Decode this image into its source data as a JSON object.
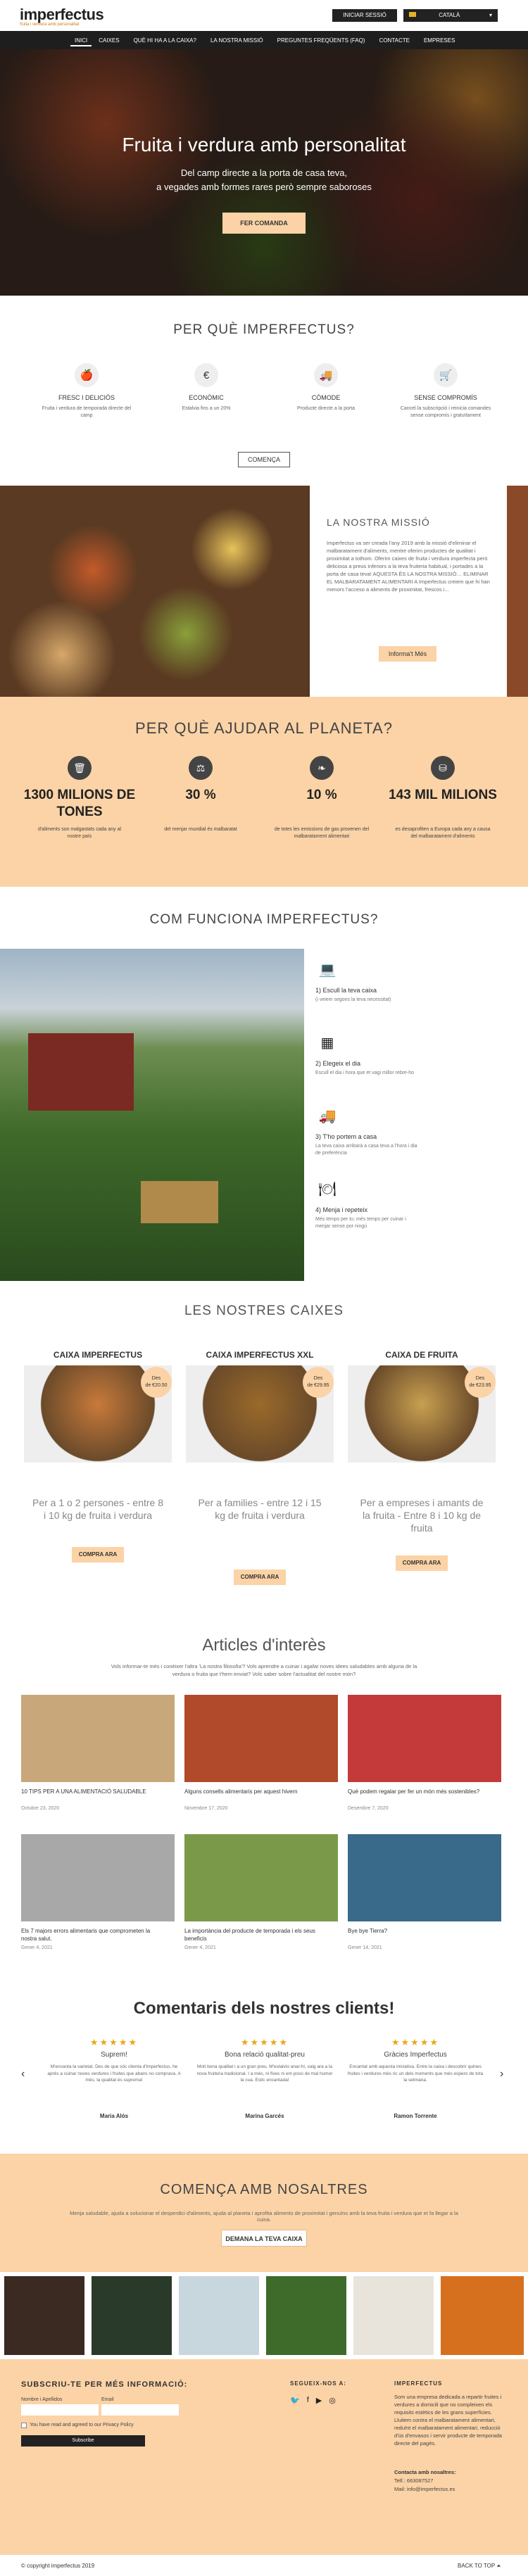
{
  "header": {
    "logo": "imperfectus",
    "tagline": "fruita i verdura amb personalitat",
    "login": "INICIAR SESSIÓ",
    "lang": "CATALÀ"
  },
  "nav": [
    "INICI",
    "CAIXES",
    "QUÈ HI HA A LA CAIXA?",
    "LA NOSTRA MISSIÓ",
    "PREGUNTES FREQÜENTS (FAQ)",
    "CONTACTE",
    "EMPRESES"
  ],
  "hero": {
    "title": "Fruita i verdura amb personalitat",
    "sub1": "Del camp directe a la porta de casa teva,",
    "sub2": "a vegades amb formes rares però sempre saboroses",
    "button": "FER COMANDA"
  },
  "why": {
    "title": "PER QUÈ IMPERFECTUS?",
    "items": [
      {
        "icon": "apple-icon",
        "title": "FRESC I DELICIÓS",
        "text": "Fruita i verdura de temporada directe del camp"
      },
      {
        "icon": "euro-icon",
        "title": "ECONÒMIC",
        "text": "Estalvia fins a un 20%"
      },
      {
        "icon": "truck-icon",
        "title": "CÒMODE",
        "text": "Producte directe a la porta"
      },
      {
        "icon": "cart-icon",
        "title": "SENSE COMPROMÍS",
        "text": "Cancel·la subscripció i reinicia comandes sense compromís i gratuïtament"
      }
    ],
    "button": "COMENÇA"
  },
  "mission": {
    "title": "LA NOSTRA MISSIÓ",
    "text": "Imperfectus va ser creada l'any 2019 amb la missió d'eliminar el malbaratament d'aliments, mentre oferim productes de qualitat i proximitat a tothom. Oferim caixes de fruita i verdura imperfecta però deliciosa a preus inferiors a la teva fruiteria habitual, i portades a la porta de casa teva! AQUESTA ÉS LA NOSTRA MISSIÓ… ELIMINAR EL MALBARATAMENT ALIMENTARI A Imperfectus creiem que hi han menors l'acceso a aliments de proximitat, frescos i...",
    "button": "Informa't Més"
  },
  "planet": {
    "title": "PER QUÈ AJUDAR AL PLANETA?",
    "stats": [
      {
        "icon": "trash-icon",
        "value": "1300 MILIONS DE TONES",
        "text": "d'aliments son malgastats cada any al nostre país"
      },
      {
        "icon": "scale-icon",
        "value": "30 %",
        "text": "del menjar mundial és malbaratat"
      },
      {
        "icon": "leaf-icon",
        "value": "10 %",
        "text": "de totes les emissions de gas provenen del malbaratament alimentari"
      },
      {
        "icon": "coins-icon",
        "value": "143 MIL MILIONS",
        "text": "es desaprofiten a Europa cada any a causa del malbaratament d'aliments"
      }
    ]
  },
  "how": {
    "title": "COM FUNCIONA IMPERFECTUS?",
    "steps": [
      {
        "icon": "laptop-icon",
        "title": "1) Escull la teva caixa",
        "text": "(i veiem segons la teva necessitat)"
      },
      {
        "icon": "calendar-icon",
        "title": "2) Elegeix el dia",
        "text": "Escull el dia i hora que et vagi millor rebre-ho"
      },
      {
        "icon": "delivery-icon",
        "title": "3) T'ho portem a casa",
        "text": "La teva caixa arribarà a casa teva a l'hora i dia de preferència"
      },
      {
        "icon": "cloche-icon",
        "title": "4) Menja i repeteix",
        "text": "Més temps per tu: més temps per cuinar i menjar sense por ningú"
      }
    ]
  },
  "boxes": {
    "title": "LES NOSTRES CAIXES",
    "items": [
      {
        "title": "CAIXA IMPERFECTUS",
        "badge_line1": "Des",
        "badge_line2": "de €20.50",
        "desc": "Per a 1 o 2 persones - entre 8 i 10 kg de fruita i verdura",
        "button": "COMPRA ARA"
      },
      {
        "title": "CAIXA IMPERFECTUS XXL",
        "badge_line1": "Des",
        "badge_line2": "de €29.95",
        "desc": "Per a families - entre 12 i 15 kg de fruita i verdura",
        "button": "COMPRA ARA"
      },
      {
        "title": "CAIXA DE FRUITA",
        "badge_line1": "Des",
        "badge_line2": "de €23.95",
        "desc": "Per a empreses i amants de la fruita - Entre 8 i 10 kg de fruita",
        "button": "COMPRA ARA"
      }
    ]
  },
  "articles": {
    "title": "Articles d'interès",
    "intro": "Vols informar-te més i conèixer l'altra 'La nostra filosofia'? Vols aprendre a cuinar i agafar noves idees saludables amb alguna de la verdura o fruita que t'hem enviat? Vols saber sobre l'actualitat del nostre món?",
    "items": [
      {
        "title": "10 TIPS PER A UNA ALIMENTACIÓ SALUDABLE",
        "date": "Octubre 23, 2020"
      },
      {
        "title": "Alguns consells alimentaris per aquest hivern",
        "date": "Novembre 17, 2020"
      },
      {
        "title": "Què podem regalar per fer un món més sostenibles?",
        "date": "Desembre 7, 2020"
      },
      {
        "title": "Els 7 majors errors alimentaris que comprometen la nostra salut.",
        "date": "Gener 4, 2021"
      },
      {
        "title": "La importància del producte de temporada i els seus beneficis",
        "date": "Gener 4, 2021"
      },
      {
        "title": "Bye bye Tierra?",
        "date": "Gener 14, 2021"
      }
    ]
  },
  "reviews": {
    "title": "Comentaris dels nostres clients!",
    "items": [
      {
        "stars": "★★★★★",
        "title": "Suprem!",
        "text": "M'encanta la varietat. Des de que sóc clienta d'Imperfectus, he après a cuinar noves verdures i fruites que abans no comprava. A més, la qualitat és suprema!",
        "name": "Maria Alós"
      },
      {
        "stars": "★★★★★",
        "title": "Bona relació qualitat-preu",
        "text": "Molt bona qualitat i a un gran preu. M'estalvio anar-hi, vaig ara a la nova fruiteria tradicional. I a més, ni fixes ni em poso de mal humor la cua. Estic encantada!",
        "name": "Marina Garcés"
      },
      {
        "stars": "★★★★★",
        "title": "Gràcies Imperfectus",
        "text": "Encantat amb aquesta iniciativa. Entre la caixa i descobrir quines fruites i verdures més ric un dels moments que més espero de tota la setmana.",
        "name": "Ramon Torrente"
      }
    ]
  },
  "start": {
    "title": "COMENÇA AMB NOSALTRES",
    "text": "Menja saludable, ajuda a solucionar el desperdici d'aliments, ajuda al planeta i aprofita aliments de proximitat i genuïns amb la teva fruita i verdura que et fa llegar a la cuina.",
    "button": "DEMANA LA TEVA CAIXA"
  },
  "footer": {
    "subscribe_title": "SUBSCRIU-TE PER MÉS INFORMACIÓ:",
    "name_label": "Nombre i Apellidos",
    "email_label": "Email",
    "consent": "You have read and agreed to our Privacy Policy",
    "submit": "Subscribe",
    "follow_title": "SEGUEIX-NOS A:",
    "about_title": "IMPERFECTUS",
    "about_text": "Som una empresa dedicada a repartir fruites i verdures a domicili que no compleixen els requisits estètics de les grans superfícies. Lluitem contra el malbaratament alimentari, reduïnt el malbaratament alimentari, reducció d'ús d'envasos i servir producte de temporada directe del pagès.",
    "contact_title": "Contacta amb nosaltres:",
    "tel": "Telf.: 663087527",
    "mail": "Mail: info@imperfectus.es",
    "copyright": "© copyright imperfectus 2019",
    "back": "BACK TO TOP"
  },
  "colors": {
    "peach": "#fbd3a6",
    "dark": "#222222",
    "green": "#5fae52"
  }
}
